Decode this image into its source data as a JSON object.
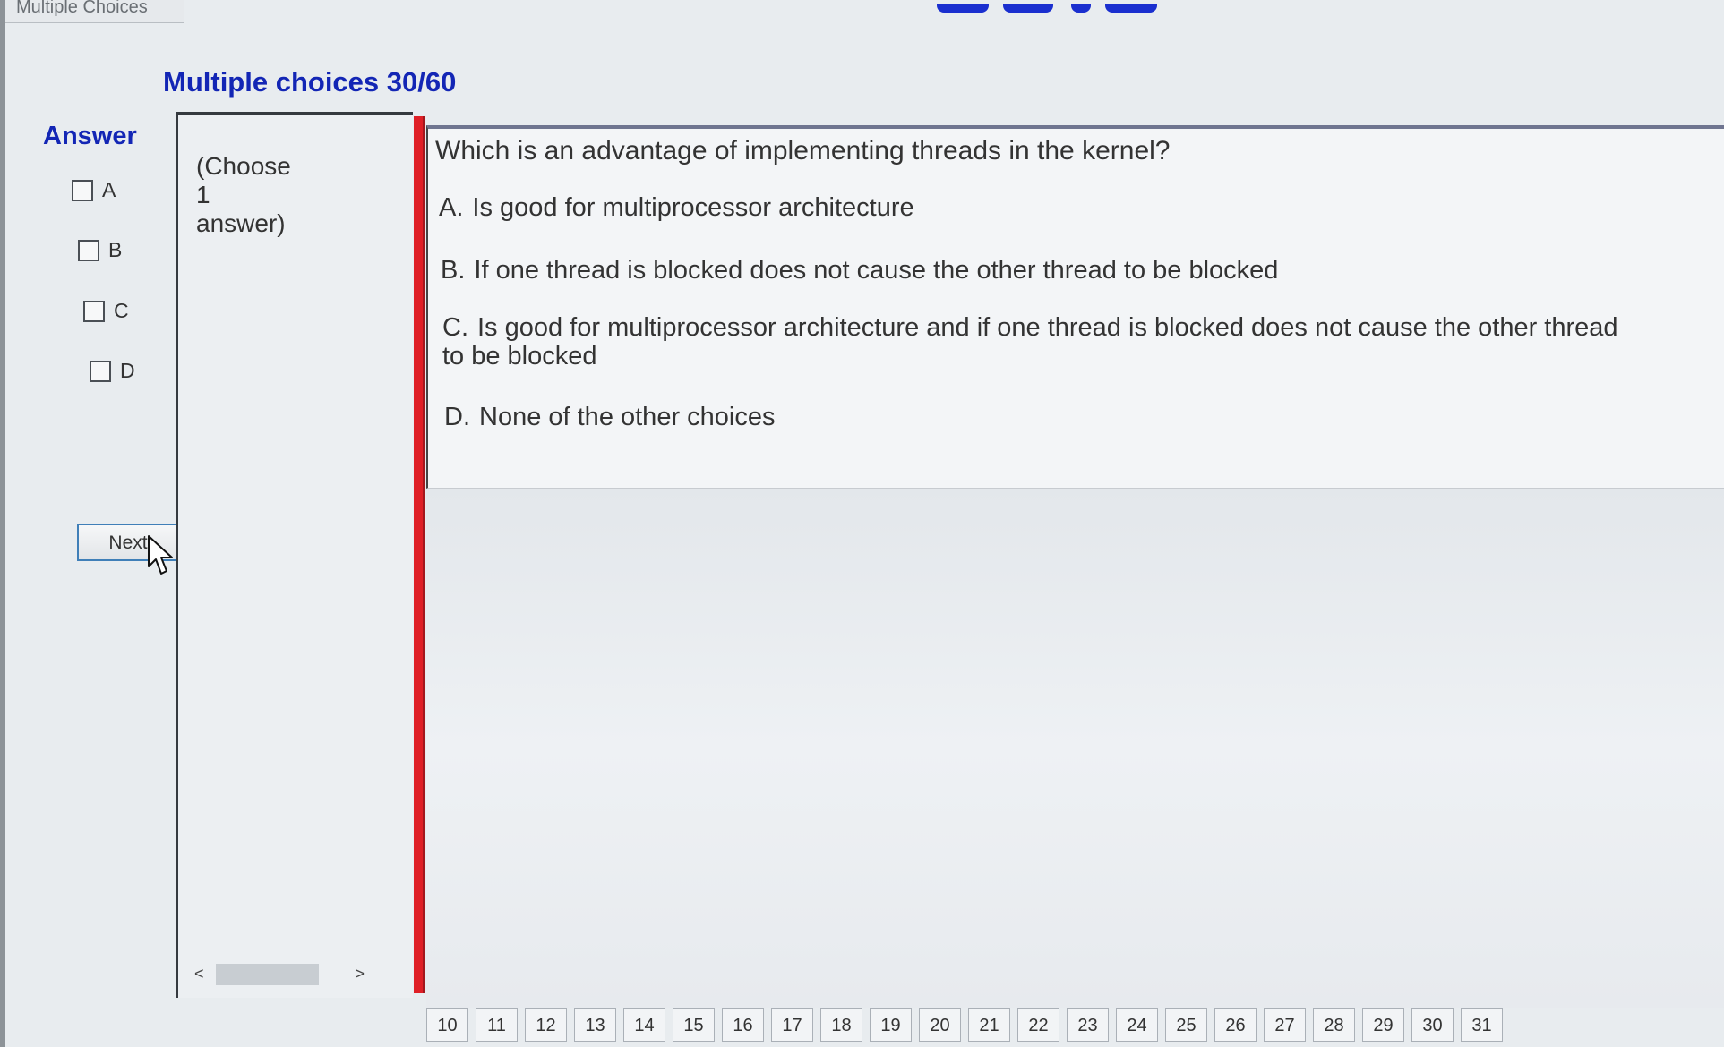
{
  "window": {
    "tab_title": "Multiple Choices"
  },
  "header": {
    "title": "Multiple choices 30/60"
  },
  "answer_panel": {
    "heading": "Answer",
    "choices": [
      {
        "label": "A",
        "checked": false
      },
      {
        "label": "B",
        "checked": false
      },
      {
        "label": "C",
        "checked": false
      },
      {
        "label": "D",
        "checked": false
      }
    ],
    "next_label": "Next"
  },
  "instruction": {
    "text": "(Choose 1 answer)",
    "scroll_left": "<",
    "scroll_right": ">"
  },
  "question": {
    "prompt": "Which is an advantage of implementing threads in the kernel?",
    "options": [
      {
        "letter": "A.",
        "text": "Is good for multiprocessor architecture"
      },
      {
        "letter": "B.",
        "text": "If one thread is blocked does not cause the other thread to be blocked"
      },
      {
        "letter": "C.",
        "text": "Is good for multiprocessor architecture and if one thread is blocked does not cause the other thread to be blocked"
      },
      {
        "letter": "D.",
        "text": "None of the other choices"
      }
    ]
  },
  "navigation": {
    "question_numbers": [
      "10",
      "11",
      "12",
      "13",
      "14",
      "15",
      "16",
      "17",
      "18",
      "19",
      "20",
      "21",
      "22",
      "23",
      "24",
      "25",
      "26",
      "27",
      "28",
      "29",
      "30",
      "31"
    ]
  },
  "colors": {
    "title_blue": "#1326b5",
    "divider_red": "#df1f26"
  },
  "icons": {
    "cursor": "arrow-cursor-icon"
  }
}
